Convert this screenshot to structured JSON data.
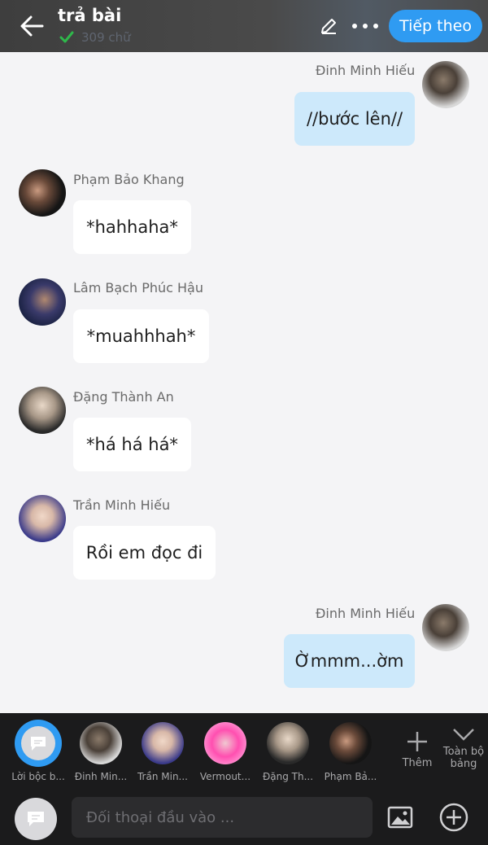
{
  "header": {
    "title": "trả bài",
    "word_count": "309 chữ",
    "next_label": "Tiếp theo"
  },
  "messages": [
    {
      "name": "Đinh Minh Hiếu",
      "text": "//bước lên//",
      "side": "right"
    },
    {
      "name": "Phạm Bảo Khang",
      "text": "*hahhaha*",
      "side": "left"
    },
    {
      "name": "Lâm Bạch Phúc Hậu",
      "text": "*muahhhah*",
      "side": "left"
    },
    {
      "name": "Đặng Thành An",
      "text": "*há há há*",
      "side": "left"
    },
    {
      "name": "Trần Minh Hiếu",
      "text": "Rồi em đọc đi",
      "side": "left"
    },
    {
      "name": "Đinh Minh Hiếu",
      "text": "Ờmmm...ờm",
      "side": "right"
    }
  ],
  "cast": [
    {
      "label": "Lời bộc b...",
      "icon": "chat-bubble-icon"
    },
    {
      "label": "Đinh Min..."
    },
    {
      "label": "Trần Min..."
    },
    {
      "label": "Vermout..."
    },
    {
      "label": "Đặng Th..."
    },
    {
      "label": "Phạm Bả..."
    }
  ],
  "cast_more_label": "Thêm",
  "all_board_label": "Toàn bộ bảng",
  "input": {
    "placeholder": "Đối thoại đầu vào ..."
  },
  "colors": {
    "accent": "#2f9bf2",
    "out_bubble": "#cde9fb",
    "in_bubble": "#ffffff",
    "background": "#f4f4f6",
    "bottom_bar": "#1b1b1c"
  }
}
